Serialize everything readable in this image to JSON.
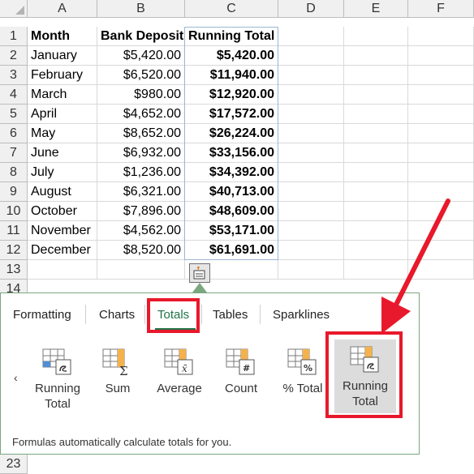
{
  "columns": [
    "A",
    "B",
    "C",
    "D",
    "E",
    "F"
  ],
  "rows": [
    {
      "num": "1",
      "month": "Month",
      "deposit": "Bank Deposit",
      "total": "Running Total",
      "header": true
    },
    {
      "num": "2",
      "month": "January",
      "deposit": "$5,420.00",
      "total": "$5,420.00"
    },
    {
      "num": "3",
      "month": "February",
      "deposit": "$6,520.00",
      "total": "$11,940.00"
    },
    {
      "num": "4",
      "month": "March",
      "deposit": "$980.00",
      "total": "$12,920.00"
    },
    {
      "num": "5",
      "month": "April",
      "deposit": "$4,652.00",
      "total": "$17,572.00"
    },
    {
      "num": "6",
      "month": "May",
      "deposit": "$8,652.00",
      "total": "$26,224.00"
    },
    {
      "num": "7",
      "month": "June",
      "deposit": "$6,932.00",
      "total": "$33,156.00"
    },
    {
      "num": "8",
      "month": "July",
      "deposit": "$1,236.00",
      "total": "$34,392.00"
    },
    {
      "num": "9",
      "month": "August",
      "deposit": "$6,321.00",
      "total": "$40,713.00"
    },
    {
      "num": "10",
      "month": "October",
      "deposit": "$7,896.00",
      "total": "$48,609.00"
    },
    {
      "num": "11",
      "month": "November",
      "deposit": "$4,562.00",
      "total": "$53,171.00"
    },
    {
      "num": "12",
      "month": "December",
      "deposit": "$8,520.00",
      "total": "$61,691.00"
    },
    {
      "num": "13",
      "month": "",
      "deposit": "",
      "total": ""
    }
  ],
  "extra_rows": [
    "14",
    "23"
  ],
  "quick_analysis": {
    "tabs": [
      "Formatting",
      "Charts",
      "Totals",
      "Tables",
      "Sparklines"
    ],
    "active_tab": "Totals",
    "tiles": [
      {
        "line1": "Running",
        "line2": "Total",
        "icon": "running-total-blue-icon"
      },
      {
        "line1": "Sum",
        "line2": "",
        "icon": "sum-icon"
      },
      {
        "line1": "Average",
        "line2": "",
        "icon": "average-icon"
      },
      {
        "line1": "Count",
        "line2": "",
        "icon": "count-icon"
      },
      {
        "line1": "% Total",
        "line2": "",
        "icon": "percent-total-icon"
      },
      {
        "line1": "Running",
        "line2": "Total",
        "icon": "running-total-orange-icon"
      }
    ],
    "scroll_left": "‹",
    "description": "Formulas automatically calculate totals for you."
  },
  "colors": {
    "accent_green": "#217346",
    "highlight_red": "#e8192c",
    "grid": "#d9d9d9",
    "header_bg": "#f0f0f0"
  }
}
